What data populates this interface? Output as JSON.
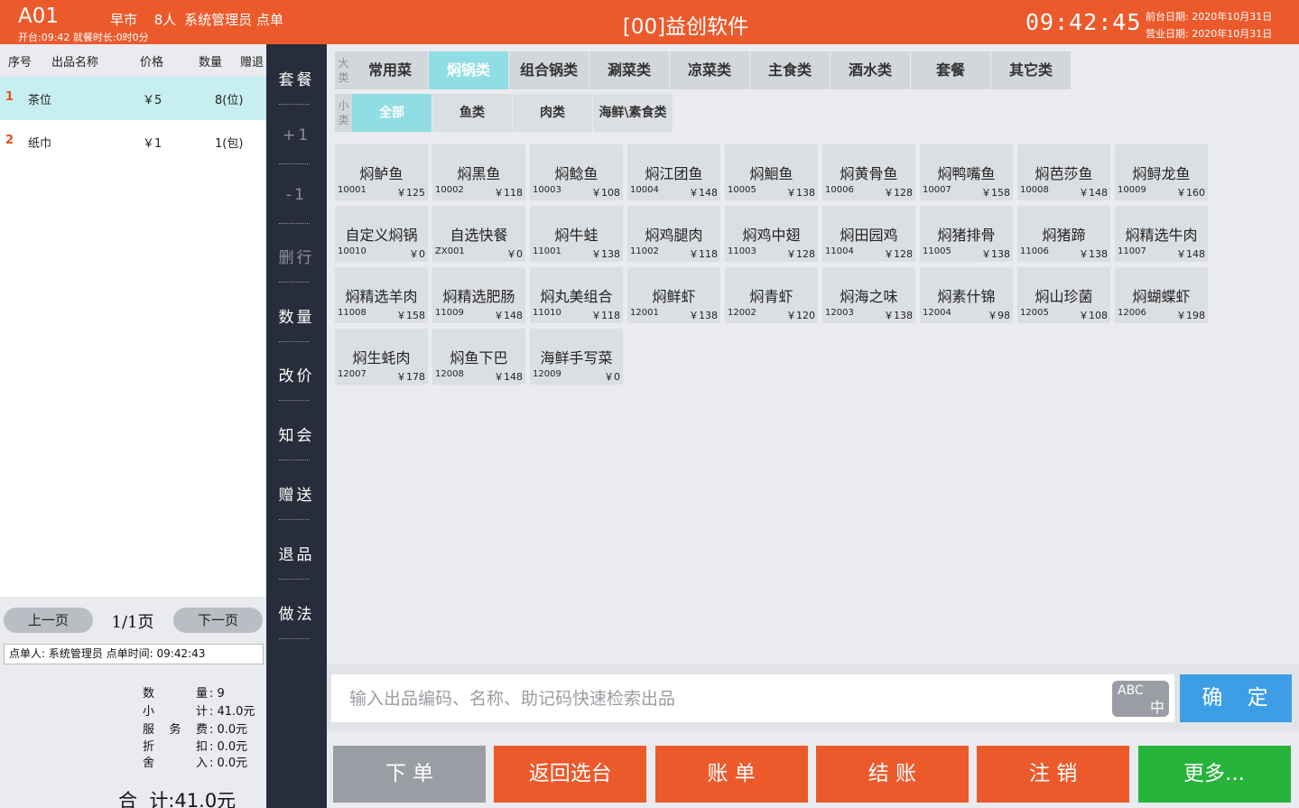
{
  "header": {
    "table": "A01",
    "meal": "早市",
    "guests": "8人",
    "operator_action": "系统管理员 点单",
    "open_info": "开台:09:42 就餐时长:0时0分",
    "title": "[00]益创软件",
    "clock": "09:42:45",
    "front_date": "前台日期: 2020年10月31日",
    "business_date": "营业日期: 2020年10月31日"
  },
  "order": {
    "columns": [
      "序号",
      "出品名称",
      "价格",
      "数量",
      "赠退"
    ],
    "rows": [
      {
        "idx": "1",
        "name": "茶位",
        "price": "￥5",
        "qty": "8(位)"
      },
      {
        "idx": "2",
        "name": "纸巾",
        "price": "￥1",
        "qty": "1(包)"
      }
    ],
    "selected_row": 1,
    "prev_page": "上一页",
    "page": "1/1页",
    "next_page": "下一页",
    "operator_line": "点单人: 系统管理员   点单时间: 09:42:43",
    "summary": [
      {
        "label": "数量",
        "value": ": 9"
      },
      {
        "label": "小计",
        "value": ": 41.0元"
      },
      {
        "label": "服务费",
        "value": ": 0.0元"
      },
      {
        "label": "折扣",
        "value": ": 0.0元"
      },
      {
        "label": "舍入",
        "value": ": 0.0元"
      }
    ],
    "total": "合  计:41.0元"
  },
  "side_actions": [
    {
      "label": "套餐",
      "dim": false
    },
    {
      "label": "+1",
      "dim": true
    },
    {
      "label": "-1",
      "dim": true
    },
    {
      "label": "删行",
      "dim": true
    },
    {
      "label": "数量",
      "dim": false
    },
    {
      "label": "改价",
      "dim": false
    },
    {
      "label": "知会",
      "dim": false
    },
    {
      "label": "赠送",
      "dim": false
    },
    {
      "label": "退品",
      "dim": false
    },
    {
      "label": "做法",
      "dim": false
    }
  ],
  "categories": {
    "big_tag": "大类",
    "small_tag": "小类",
    "big": [
      "常用菜",
      "焖锅类",
      "组合锅类",
      "涮菜类",
      "凉菜类",
      "主食类",
      "酒水类",
      "套餐",
      "其它类"
    ],
    "big_selected": 1,
    "small": [
      "全部",
      "鱼类",
      "肉类",
      "海鲜\\素食类"
    ],
    "small_selected": 0
  },
  "dishes": [
    {
      "name": "焖鲈鱼",
      "code": "10001",
      "price": "￥125"
    },
    {
      "name": "焖黑鱼",
      "code": "10002",
      "price": "￥118"
    },
    {
      "name": "焖鲶鱼",
      "code": "10003",
      "price": "￥108"
    },
    {
      "name": "焖江团鱼",
      "code": "10004",
      "price": "￥148"
    },
    {
      "name": "焖鮰鱼",
      "code": "10005",
      "price": "￥138"
    },
    {
      "name": "焖黄骨鱼",
      "code": "10006",
      "price": "￥128"
    },
    {
      "name": "焖鸭嘴鱼",
      "code": "10007",
      "price": "￥158"
    },
    {
      "name": "焖芭莎鱼",
      "code": "10008",
      "price": "￥148"
    },
    {
      "name": "焖鲟龙鱼",
      "code": "10009",
      "price": "￥160"
    },
    {
      "name": "自定义焖锅",
      "code": "10010",
      "price": "￥0"
    },
    {
      "name": "自选快餐",
      "code": "ZX001",
      "price": "￥0"
    },
    {
      "name": "焖牛蛙",
      "code": "11001",
      "price": "￥138"
    },
    {
      "name": "焖鸡腿肉",
      "code": "11002",
      "price": "￥118"
    },
    {
      "name": "焖鸡中翅",
      "code": "11003",
      "price": "￥128"
    },
    {
      "name": "焖田园鸡",
      "code": "11004",
      "price": "￥128"
    },
    {
      "name": "焖猪排骨",
      "code": "11005",
      "price": "￥138"
    },
    {
      "name": "焖猪蹄",
      "code": "11006",
      "price": "￥138"
    },
    {
      "name": "焖精选牛肉",
      "code": "11007",
      "price": "￥148"
    },
    {
      "name": "焖精选羊肉",
      "code": "11008",
      "price": "￥158"
    },
    {
      "name": "焖精选肥肠",
      "code": "11009",
      "price": "￥148"
    },
    {
      "name": "焖丸美组合",
      "code": "11010",
      "price": "￥118"
    },
    {
      "name": "焖鲜虾",
      "code": "12001",
      "price": "￥138"
    },
    {
      "name": "焖青虾",
      "code": "12002",
      "price": "￥120"
    },
    {
      "name": "焖海之味",
      "code": "12003",
      "price": "￥138"
    },
    {
      "name": "焖素什锦",
      "code": "12004",
      "price": "￥98"
    },
    {
      "name": "焖山珍菌",
      "code": "12005",
      "price": "￥108"
    },
    {
      "name": "焖蝴蝶虾",
      "code": "12006",
      "price": "￥198"
    },
    {
      "name": "焖生蚝肉",
      "code": "12007",
      "price": "￥178"
    },
    {
      "name": "焖鱼下巴",
      "code": "12008",
      "price": "￥148"
    },
    {
      "name": "海鲜手写菜",
      "code": "12009",
      "price": "￥0"
    }
  ],
  "search": {
    "placeholder": "输入出品编码、名称、助记码快速检索出品",
    "ime_top": "ABC",
    "ime_bottom": "中",
    "confirm": "确 定"
  },
  "bottom_buttons": [
    {
      "label": "下 单",
      "style": "gray"
    },
    {
      "label": "返回选台",
      "style": "orange"
    },
    {
      "label": "账 单",
      "style": "orange"
    },
    {
      "label": "结 账",
      "style": "orange"
    },
    {
      "label": "注 销",
      "style": "orange"
    },
    {
      "label": "更多...",
      "style": "green"
    }
  ],
  "colors": {
    "brand_orange": "#ec5a2c",
    "selected_teal": "#90dde3",
    "confirm_blue": "#3d9ee5",
    "more_green": "#27b33b",
    "side_dark": "#282d3c"
  }
}
